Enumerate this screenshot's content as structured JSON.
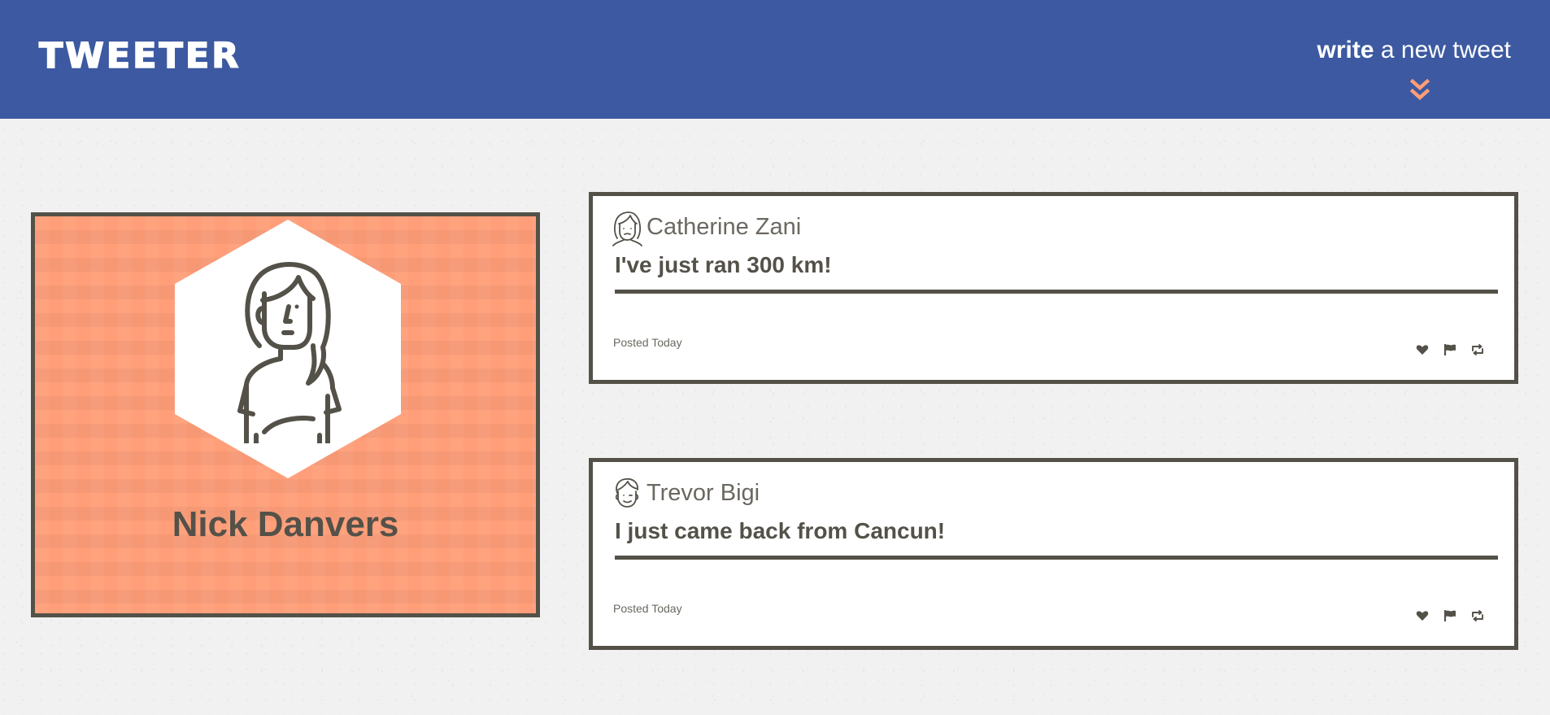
{
  "header": {
    "logo": "Tweeter",
    "compose_strong": "write",
    "compose_light": "a new tweet",
    "compose_icon": "double-chevron-down-icon",
    "background": "#3c59a1",
    "accent": "#ff9e78"
  },
  "profile": {
    "name": "Nick Danvers",
    "background": "#ff9e78",
    "avatar_icon": "user-avatar-icon"
  },
  "tweets": [
    {
      "author": "Catherine Zani",
      "text": "I've just ran 300 km!",
      "posted": "Posted Today",
      "avatar_icon": "woman-avatar-icon",
      "actions": [
        "heart-icon",
        "flag-icon",
        "retweet-icon"
      ]
    },
    {
      "author": "Trevor Bigi",
      "text": "I just came back from Cancun!",
      "posted": "Posted Today",
      "avatar_icon": "man-avatar-icon",
      "actions": [
        "heart-icon",
        "flag-icon",
        "retweet-icon"
      ]
    }
  ]
}
